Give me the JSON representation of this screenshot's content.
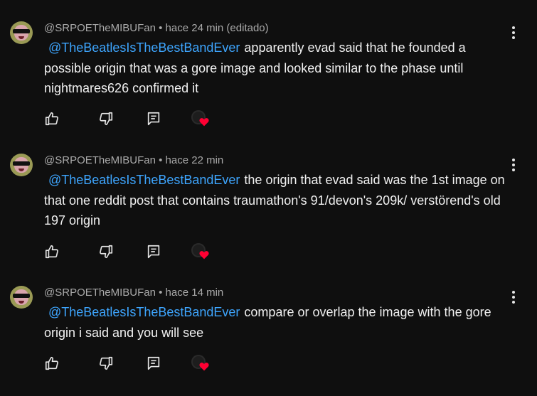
{
  "comments": [
    {
      "author": "@SRPOETheMIBUFan",
      "separator": "•",
      "time": "hace 24 min (editado)",
      "mention": "@TheBeatlesIsTheBestBandEver",
      "text": "apparently evad said that he founded a possible origin that was a gore image and looked similar to the phase until nightmares626 confirmed it"
    },
    {
      "author": "@SRPOETheMIBUFan",
      "separator": "•",
      "time": "hace 22 min",
      "mention": "@TheBeatlesIsTheBestBandEver",
      "text": "the origin that evad said was the 1st image on that one reddit post that contains traumathon's 91/devon's 209k/ verstörend's old 197 origin"
    },
    {
      "author": "@SRPOETheMIBUFan",
      "separator": "•",
      "time": "hace 14 min",
      "mention": "@TheBeatlesIsTheBestBandEver",
      "text": "compare or overlap the image with the gore origin i said and you will see"
    }
  ],
  "icons": {
    "like": "thumbs-up-icon",
    "dislike": "thumbs-down-icon",
    "reply": "reply-icon",
    "more": "more-vertical-icon",
    "creator_heart": "heart-icon"
  },
  "colors": {
    "background": "#0f0f0f",
    "text": "#f1f1f1",
    "meta": "#aaaaaa",
    "mention": "#3ea6ff",
    "heart": "#ff0033"
  }
}
